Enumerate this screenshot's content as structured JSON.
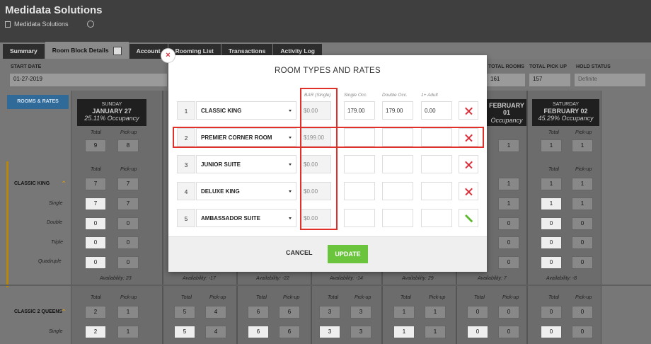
{
  "app": {
    "title": "Medidata Solutions",
    "subtitle": "Medidata Solutions"
  },
  "tabs": [
    "Summary",
    "Room Block Details",
    "Account",
    "Rooming List",
    "Transactions",
    "Activity Log"
  ],
  "fields": {
    "start_date_label": "START DATE",
    "start_date": "01-27-2019",
    "total_rooms_label": "TOTAL ROOMS",
    "total_rooms": "161",
    "total_pickup_label": "TOTAL PICK UP",
    "total_pickup": "157",
    "hold_status_label": "HOLD STATUS",
    "hold_status": "Definite"
  },
  "rooms_rates_button": "ROOMS & RATES",
  "days": [
    {
      "dow": "SUNDAY",
      "date": "JANUARY 27",
      "occ": "25.11% Occupancy"
    },
    {
      "dow": "",
      "date": "FEBRUARY 01",
      "occ": "Occupancy"
    },
    {
      "dow": "SATURDAY",
      "date": "FEBRUARY 02",
      "occ": "45.29% Occupancy"
    }
  ],
  "grid": {
    "total": "Total",
    "pickup": "Pick-up",
    "day1_totals": [
      "9",
      "8"
    ],
    "classic_king": "CLASSIC KING",
    "classic_2_queens": "CLASSIC 2 QUEENS",
    "rows": [
      "Single",
      "Double",
      "Triple",
      "Quadruple"
    ],
    "ck_values": [
      [
        "7",
        "7"
      ],
      [
        "7",
        "7"
      ],
      [
        "0",
        "0"
      ],
      [
        "0",
        "0"
      ],
      [
        "0",
        "0"
      ]
    ],
    "q_values": [
      [
        "2",
        "1"
      ],
      [
        "2",
        "1"
      ]
    ],
    "availability": [
      "Availability: 23",
      "Availability: -17",
      "Availability: -22",
      "Availability: -14",
      "Availability: 29",
      "Availability: 7",
      "Availability: -8"
    ],
    "right_cols": {
      "c1": [
        "1",
        "1"
      ],
      "c2": [
        "1",
        "1"
      ],
      "ck1": [
        [
          "1",
          "1"
        ],
        [
          "1",
          "1"
        ],
        [
          "0",
          "0"
        ],
        [
          "0",
          "0"
        ],
        [
          "0",
          "0"
        ]
      ],
      "ck2": [
        [
          "1",
          "1"
        ],
        [
          "1",
          "1"
        ],
        [
          "0",
          "0"
        ],
        [
          "0",
          "0"
        ],
        [
          "0",
          "0"
        ]
      ]
    },
    "middle_q": [
      [
        "5",
        "4"
      ],
      [
        "5",
        "4"
      ],
      [
        "6",
        "6"
      ],
      [
        "6",
        "6"
      ],
      [
        "3",
        "3"
      ],
      [
        "3",
        "3"
      ],
      [
        "1",
        "1"
      ],
      [
        "1",
        "1"
      ],
      [
        "0",
        "0"
      ],
      [
        "0",
        "0"
      ],
      [
        "0",
        "0"
      ],
      [
        "0",
        "0"
      ]
    ]
  },
  "modal": {
    "title": "ROOM TYPES AND RATES",
    "headers": {
      "bar": "BAR (Single)",
      "single": "Single Occ.",
      "double": "Double Occ.",
      "adult": "1+ Adult"
    },
    "rows": [
      {
        "num": "1",
        "name": "CLASSIC KING",
        "bar": "$0.00",
        "single": "179.00",
        "double": "179.00",
        "adult": "0.00",
        "action": "remove"
      },
      {
        "num": "2",
        "name": "PREMIER CORNER ROOM",
        "bar": "$199.00",
        "single": "",
        "double": "",
        "adult": "",
        "action": "remove"
      },
      {
        "num": "3",
        "name": "JUNIOR SUITE",
        "bar": "$0.00",
        "single": "",
        "double": "",
        "adult": "",
        "action": "remove"
      },
      {
        "num": "4",
        "name": "DELUXE KING",
        "bar": "$0.00",
        "single": "",
        "double": "",
        "adult": "",
        "action": "remove"
      },
      {
        "num": "5",
        "name": "AMBASSADOR SUITE",
        "bar": "$0.00",
        "single": "",
        "double": "",
        "adult": "",
        "action": "add"
      }
    ],
    "cancel": "CANCEL",
    "update": "UPDATE",
    "close": "×"
  }
}
